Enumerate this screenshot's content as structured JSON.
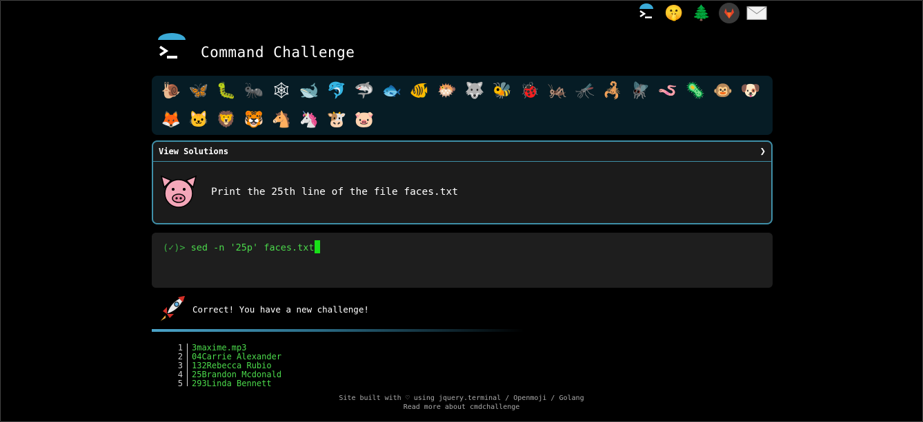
{
  "header": {
    "title": "Command Challenge",
    "top_icons": [
      {
        "name": "terminal-icon",
        "glyph": "▶"
      },
      {
        "name": "shushing-face-icon",
        "glyph": "🤫"
      },
      {
        "name": "tree-icon",
        "glyph": "🌲"
      },
      {
        "name": "gitlab-icon",
        "glyph": "🦊"
      },
      {
        "name": "mail-icon",
        "glyph": "✉"
      }
    ]
  },
  "animals_row1": [
    {
      "name": "snail",
      "glyph": "🐌"
    },
    {
      "name": "butterfly",
      "glyph": "🦋"
    },
    {
      "name": "caterpillar",
      "glyph": "🐛"
    },
    {
      "name": "ant",
      "glyph": "🐜"
    },
    {
      "name": "spider-web",
      "glyph": "🕸"
    },
    {
      "name": "whale",
      "glyph": "🐋"
    },
    {
      "name": "dolphin",
      "glyph": "🐬"
    },
    {
      "name": "shark",
      "glyph": "🦈"
    },
    {
      "name": "fish",
      "glyph": "🐟"
    },
    {
      "name": "tropical-fish",
      "glyph": "🐠"
    },
    {
      "name": "blowfish",
      "glyph": "🐡"
    },
    {
      "name": "wolf",
      "glyph": "🐺"
    },
    {
      "name": "bee",
      "glyph": "🐝"
    },
    {
      "name": "lady-beetle",
      "glyph": "🐞"
    },
    {
      "name": "cricket",
      "glyph": "🦗"
    },
    {
      "name": "mosquito",
      "glyph": "🦟"
    },
    {
      "name": "scorpion",
      "glyph": "🦂"
    },
    {
      "name": "fly",
      "glyph": "🪰"
    },
    {
      "name": "worm",
      "glyph": "🪱"
    },
    {
      "name": "microbe",
      "glyph": "🦠"
    },
    {
      "name": "monkey",
      "glyph": "🐵"
    },
    {
      "name": "dog",
      "glyph": "🐶"
    }
  ],
  "animals_row2": [
    {
      "name": "fox",
      "glyph": "🦊"
    },
    {
      "name": "cat",
      "glyph": "🐱"
    },
    {
      "name": "lion",
      "glyph": "🦁"
    },
    {
      "name": "tiger",
      "glyph": "🐯"
    },
    {
      "name": "horse",
      "glyph": "🐴"
    },
    {
      "name": "unicorn",
      "glyph": "🦄"
    },
    {
      "name": "cow",
      "glyph": "🐮"
    },
    {
      "name": "pig",
      "glyph": "🐷"
    }
  ],
  "solutions": {
    "header": "View Solutions",
    "chevron": "❯",
    "task": "Print the 25th line of the file faces.txt"
  },
  "terminal": {
    "prompt": "(✓)>",
    "command": "sed -n '25p' faces.txt"
  },
  "result": {
    "message": "Correct! You have a new challenge!"
  },
  "file_lines": [
    {
      "n": "1",
      "text": "3maxime.mp3"
    },
    {
      "n": "2",
      "text": "04Carrie Alexander"
    },
    {
      "n": "3",
      "text": "132Rebecca Rubio"
    },
    {
      "n": "4",
      "text": "25Brandon Mcdonald"
    },
    {
      "n": "5",
      "text": "293Linda Bennett"
    }
  ],
  "footer": {
    "line1": "Site built with ♡ using jquery.terminal / Openmoji / Golang",
    "line2": "Read more about cmdchallenge"
  }
}
